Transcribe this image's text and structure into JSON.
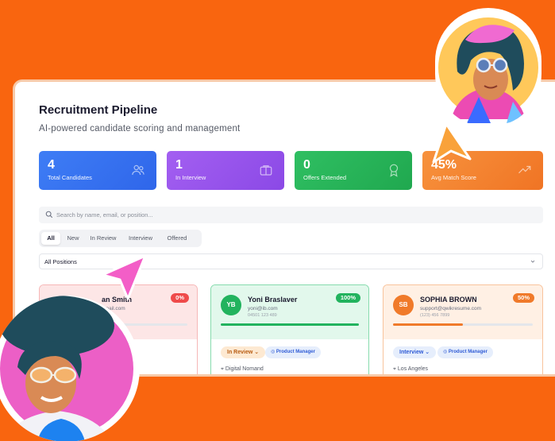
{
  "header": {
    "title": "Recruitment Pipeline",
    "subtitle": "AI-powered candidate scoring and management"
  },
  "stats": [
    {
      "value": "4",
      "label": "Total Candidates",
      "icon": "users-icon",
      "color": "#3e7df5"
    },
    {
      "value": "1",
      "label": "In Interview",
      "icon": "briefcase-icon",
      "color": "#a35ff1"
    },
    {
      "value": "0",
      "label": "Offers Extended",
      "icon": "award-icon",
      "color": "#2fbf62"
    },
    {
      "value": "45%",
      "label": "Avg Match Score",
      "icon": "trending-up-icon",
      "color": "#f7923d"
    }
  ],
  "search": {
    "placeholder": "Search by name, email, or position..."
  },
  "tabs": [
    "All",
    "New",
    "In Review",
    "Interview",
    "Offered"
  ],
  "filter": {
    "selected": "All Positions"
  },
  "candidates": [
    {
      "initials": "",
      "name": "an Smith",
      "email": "email.com",
      "phone": "",
      "score": "0%",
      "score_value": 0,
      "status": "",
      "role": "",
      "location": ""
    },
    {
      "initials": "YB",
      "name": "Yoni Braslaver",
      "email": "yoni@ib.com",
      "phone": "04501 123 489",
      "score": "100%",
      "score_value": 1.0,
      "status": "In Review",
      "role": "Product Manager",
      "location": "Digital Nomand"
    },
    {
      "initials": "SB",
      "name": "SOPHIA BROWN",
      "email": "support@qwikresume.com",
      "phone": "(123) 456 7899",
      "score": "50%",
      "score_value": 0.5,
      "status": "Interview",
      "role": "Product Manager",
      "location": "Los Angeles"
    }
  ]
}
